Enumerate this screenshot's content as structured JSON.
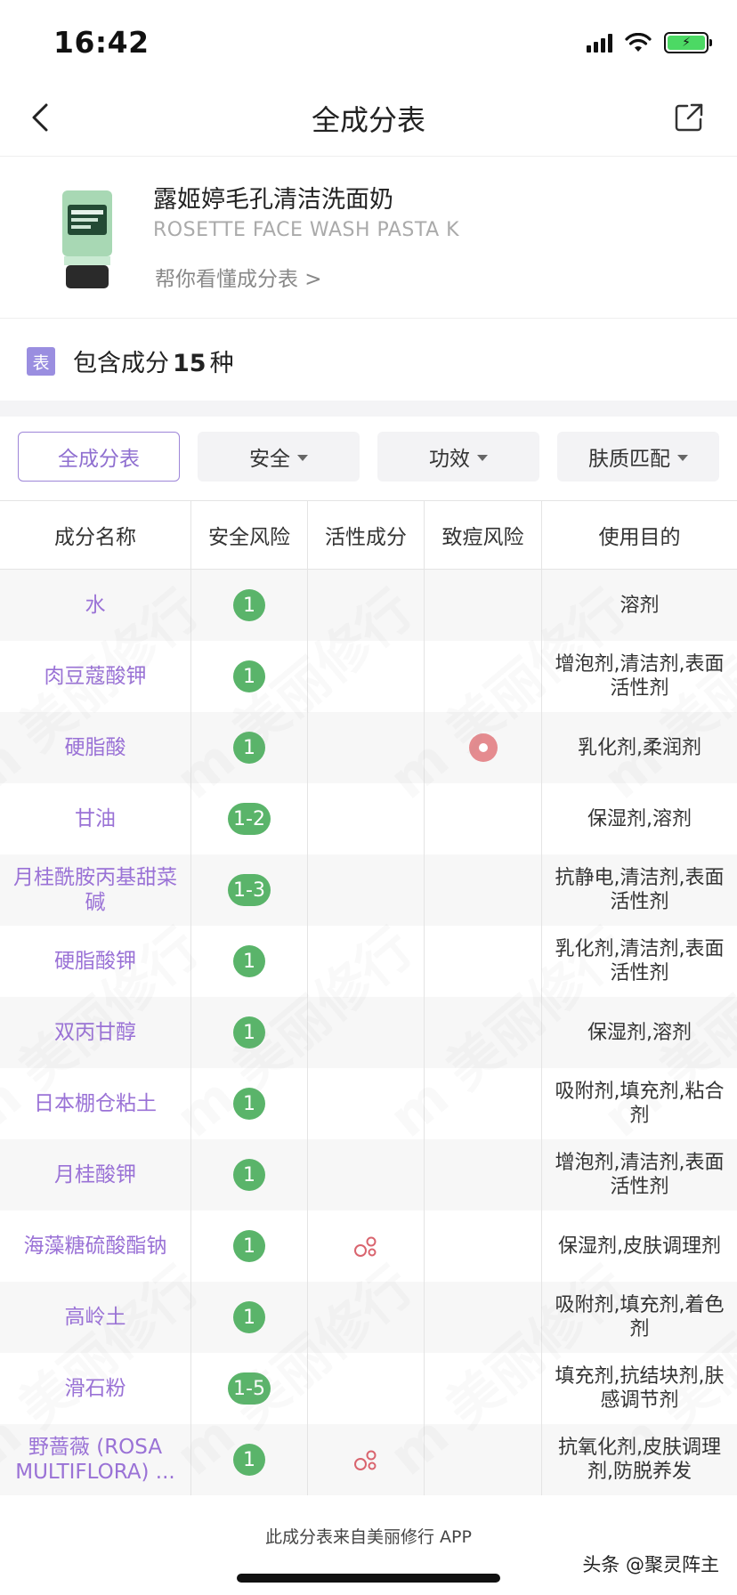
{
  "status_bar": {
    "time": "16:42"
  },
  "nav": {
    "title": "全成分表",
    "back_icon": "chevron-left-icon",
    "share_icon": "share-icon"
  },
  "product": {
    "name": "露姬婷毛孔清洁洗面奶",
    "name_en": "ROSETTE FACE WASH PASTA K",
    "link": "帮你看懂成分表 >"
  },
  "summary": {
    "badge": "表",
    "prefix": "包含成分",
    "count": "15",
    "suffix": "种"
  },
  "tabs": [
    {
      "label": "全成分表",
      "active": true,
      "dropdown": false
    },
    {
      "label": "安全",
      "active": false,
      "dropdown": true
    },
    {
      "label": "功效",
      "active": false,
      "dropdown": true
    },
    {
      "label": "肤质匹配",
      "active": false,
      "dropdown": true
    }
  ],
  "table": {
    "headers": [
      "成分名称",
      "安全风险",
      "活性成分",
      "致痘风险",
      "使用目的"
    ],
    "rows": [
      {
        "name": "水",
        "risk": "1",
        "active": false,
        "acne": false,
        "purpose": "溶剂"
      },
      {
        "name": "肉豆蔻酸钾",
        "risk": "1",
        "active": false,
        "acne": false,
        "purpose": "增泡剂,清洁剂,表面活性剂"
      },
      {
        "name": "硬脂酸",
        "risk": "1",
        "active": false,
        "acne": true,
        "purpose": "乳化剂,柔润剂"
      },
      {
        "name": "甘油",
        "risk": "1-2",
        "active": false,
        "acne": false,
        "purpose": "保湿剂,溶剂"
      },
      {
        "name": "月桂酰胺丙基甜菜碱",
        "risk": "1-3",
        "active": false,
        "acne": false,
        "purpose": "抗静电,清洁剂,表面活性剂"
      },
      {
        "name": "硬脂酸钾",
        "risk": "1",
        "active": false,
        "acne": false,
        "purpose": "乳化剂,清洁剂,表面活性剂"
      },
      {
        "name": "双丙甘醇",
        "risk": "1",
        "active": false,
        "acne": false,
        "purpose": "保湿剂,溶剂"
      },
      {
        "name": "日本棚仓粘土",
        "risk": "1",
        "active": false,
        "acne": false,
        "purpose": "吸附剂,填充剂,粘合剂"
      },
      {
        "name": "月桂酸钾",
        "risk": "1",
        "active": false,
        "acne": false,
        "purpose": "增泡剂,清洁剂,表面活性剂"
      },
      {
        "name": "海藻糖硫酸酯钠",
        "risk": "1",
        "active": true,
        "acne": false,
        "purpose": "保湿剂,皮肤调理剂"
      },
      {
        "name": "高岭土",
        "risk": "1",
        "active": false,
        "acne": false,
        "purpose": "吸附剂,填充剂,着色剂"
      },
      {
        "name": "滑石粉",
        "risk": "1-5",
        "active": false,
        "acne": false,
        "purpose": "填充剂,抗结块剂,肤感调节剂"
      },
      {
        "name": "野蔷薇 (ROSA MULTIFLORA) ...",
        "risk": "1",
        "active": true,
        "acne": false,
        "purpose": "抗氧化剂,皮肤调理剂,防脱养发"
      }
    ]
  },
  "footer": {
    "source": "此成分表来自美丽修行 APP",
    "attribution": "头条 @聚灵阵主"
  },
  "colors": {
    "accent": "#9a72d6",
    "risk_green": "#5ab46a",
    "acne_red": "#e58b8f"
  }
}
